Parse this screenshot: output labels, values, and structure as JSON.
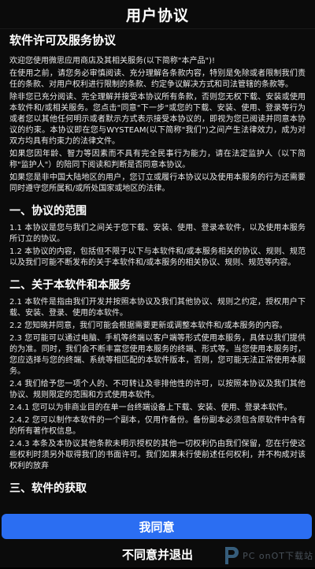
{
  "header": {
    "title": "用户协议"
  },
  "doc": {
    "title": "软件许可及服务协议",
    "intro": [
      "欢迎您使用微思应用商店及其相关服务(以下简称\"本产品\")!",
      "在使用之前，请您务必审慎阅读、充分理解各条款内容，特别是免除或者限制我们责任的条款、对用户权利进行限制的条款、约定争议解决方式和司法管辖的条款等。",
      "除非您已充分阅读、完全理解并接受本协议所有条款，否则您无权下载、安装或使用本软件和/或相关服务。您点击\"同意\"下一步\"或您的下载、安装、使用、登录等行为或者您以其他任何明示或者默示方式表示接受本协议的，即视为您已阅读并同意本协议的约束。本协议即在您与WYSTEAM(以下简称\"我们\")之间产生法律效力，成为对双方均具有约束力的法律文件。",
      "如果您因年龄、智力等因素而不具有完全民事行为能力，请在法定监护人（以下简称\"监护人\"）的陪同下阅读和判断是否同意本协议。",
      "如果您是非中国大陆地区的用户，您订立或履行本协议以及使用本服务的行为还需要同时遵守您所属和/或所处国家或地区的法律。"
    ],
    "sections": [
      {
        "heading": "一、协议的范围",
        "paragraphs": [
          "1.1 本协议是您与我们之间关于您下载、安装、使用、登录本软件，以及使用本服务所订立的协议。",
          "1.2 本协议的内容，包括但不限于以下与本软件和/或本服务相关的协议、规则、规范以及我们可能不断发布的关于本软件和/或本服务的相关协议、规则、规范等内容。"
        ]
      },
      {
        "heading": "二、关于本软件和本服务",
        "paragraphs": [
          "2.1 本软件是指由我们开发并按照本协议及我们其他协议、规则之约定，授权用户下载、安装、登录、使用的本软件。",
          "2.2 您知晓并同意，我们可能会根据需要更新或调整本软件和/或本服务的内容。",
          "2.3 您可能可以通过电脑、手机等终端以客户端等形式使用本服务，具体以我们提供的为准。同时，我们会不断丰富您使用本服务的终端、形式等。当您使用本服务时，您应选择与您的终端、系统等相匹配的本软件版本，否则，您可能无法正常使用本服务。",
          "2.4 我们给予您一项个人的、不可转让及非排他性的许可，以按照本协议及我们其他协议、规则限定的范围和方式使用本软件。",
          "2.4.1 您可以为非商业目的在单一台终端设备上下载、安装、使用、登录本软件。",
          "2.4.2 您可以制作本软件的一个副本，仅用作备份。备份副本必须包含原软件中含有的所有著作权信息。",
          "2.4.3 本条及本协议其他条款未明示授权的其他一切权利仍由我们保留，您在行使这些权利时须另外取得我们的书面许可。我们如果未行使前述任何权利，并不构成对该权利的放弃"
        ]
      },
      {
        "heading": "三、软件的获取",
        "paragraphs": []
      }
    ]
  },
  "buttons": {
    "agree_label": "我同意",
    "decline_label": "不同意并退出"
  },
  "watermark": {
    "text": "PC onOT下载站"
  },
  "colors": {
    "accent": "#2b6ef2",
    "background": "#0b0b0b",
    "text": "#f0f0f0"
  }
}
